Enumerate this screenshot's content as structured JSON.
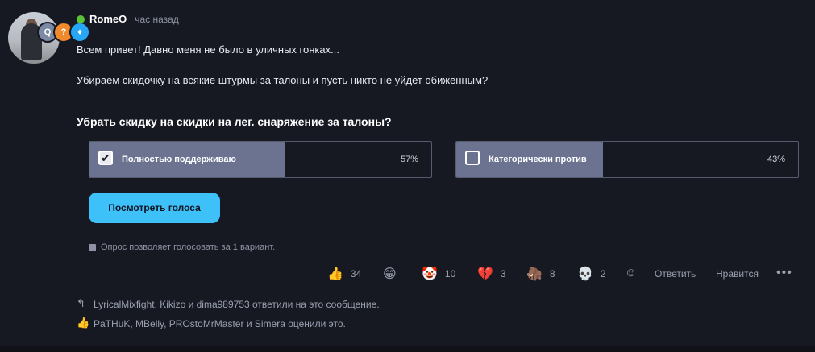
{
  "post": {
    "username": "RomeO",
    "time": "час назад",
    "line1": "Всем привет! Давно меня не было в уличных гонках...",
    "line2": "Убираем скидочку на всякие штурмы за талоны и пусть никто не уйдет обиженным?"
  },
  "badges": [
    "Q",
    "?",
    "♦"
  ],
  "poll": {
    "question": "Убрать скидку на скидки на лег. снаряжение за талоны?",
    "options": [
      {
        "label": "Полностью поддерживаю",
        "percent_text": "57%",
        "percent": 57,
        "checked": true
      },
      {
        "label": "Категорически против",
        "percent_text": "43%",
        "percent": 43,
        "checked": false
      }
    ],
    "votes_button": "Посмотреть голоса",
    "note": "Опрос позволяет голосовать за 1 вариант."
  },
  "reactions": [
    {
      "icon": "thumbs-up-icon",
      "glyph": "👍",
      "count": "34"
    },
    {
      "icon": "grin-icon",
      "glyph": "😁",
      "count": ""
    },
    {
      "icon": "clown-icon",
      "glyph": "🤡",
      "count": "10"
    },
    {
      "icon": "broken-heart-icon",
      "glyph": "💔",
      "count": "3"
    },
    {
      "icon": "mammoth-icon",
      "glyph": "🦣",
      "count": "8"
    },
    {
      "icon": "skull-icon",
      "glyph": "💀",
      "count": "2"
    }
  ],
  "actions": {
    "reply": "Ответить",
    "like": "Нравится",
    "more": "•••"
  },
  "footer": {
    "replied": "LyricalMixfight, Kikizo и dima989753 ответили на это сообщение.",
    "liked": "PaTHuK, MBelly, PROstoMrMaster и Simera оценили это."
  },
  "colors": {
    "background": "#161922",
    "accent": "#3ec1f8",
    "poll_fill": "#6c7390",
    "online": "#5bc236"
  }
}
